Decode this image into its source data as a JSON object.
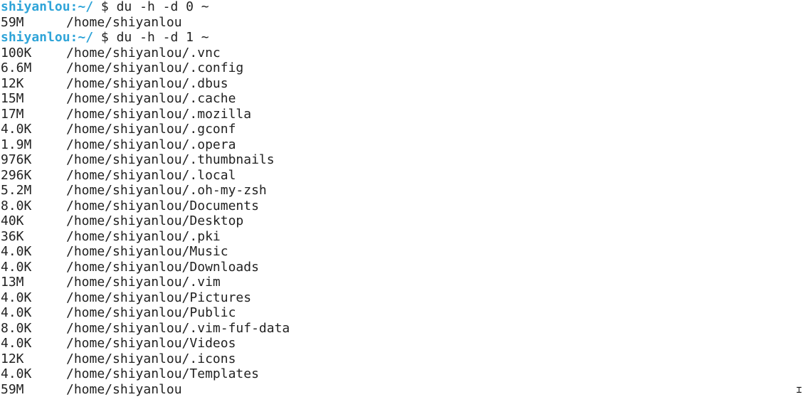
{
  "terminal": {
    "prompt": {
      "user": "shiyanlou",
      "separator": ":",
      "path": "~/",
      "symbol": " $ "
    },
    "colors": {
      "prompt": "#2fa4d8",
      "text": "#222222",
      "background": "#ffffff"
    },
    "session": [
      {
        "kind": "command",
        "text": "du -h -d 0 ~"
      },
      {
        "kind": "output",
        "size": "59M",
        "path": "/home/shiyanlou"
      },
      {
        "kind": "command",
        "text": "du -h -d 1 ~"
      },
      {
        "kind": "output",
        "size": "100K",
        "path": "/home/shiyanlou/.vnc"
      },
      {
        "kind": "output",
        "size": "6.6M",
        "path": "/home/shiyanlou/.config"
      },
      {
        "kind": "output",
        "size": "12K",
        "path": "/home/shiyanlou/.dbus"
      },
      {
        "kind": "output",
        "size": "15M",
        "path": "/home/shiyanlou/.cache"
      },
      {
        "kind": "output",
        "size": "17M",
        "path": "/home/shiyanlou/.mozilla"
      },
      {
        "kind": "output",
        "size": "4.0K",
        "path": "/home/shiyanlou/.gconf"
      },
      {
        "kind": "output",
        "size": "1.9M",
        "path": "/home/shiyanlou/.opera"
      },
      {
        "kind": "output",
        "size": "976K",
        "path": "/home/shiyanlou/.thumbnails"
      },
      {
        "kind": "output",
        "size": "296K",
        "path": "/home/shiyanlou/.local"
      },
      {
        "kind": "output",
        "size": "5.2M",
        "path": "/home/shiyanlou/.oh-my-zsh"
      },
      {
        "kind": "output",
        "size": "8.0K",
        "path": "/home/shiyanlou/Documents"
      },
      {
        "kind": "output",
        "size": "40K",
        "path": "/home/shiyanlou/Desktop"
      },
      {
        "kind": "output",
        "size": "36K",
        "path": "/home/shiyanlou/.pki"
      },
      {
        "kind": "output",
        "size": "4.0K",
        "path": "/home/shiyanlou/Music"
      },
      {
        "kind": "output",
        "size": "4.0K",
        "path": "/home/shiyanlou/Downloads"
      },
      {
        "kind": "output",
        "size": "13M",
        "path": "/home/shiyanlou/.vim"
      },
      {
        "kind": "output",
        "size": "4.0K",
        "path": "/home/shiyanlou/Pictures"
      },
      {
        "kind": "output",
        "size": "4.0K",
        "path": "/home/shiyanlou/Public"
      },
      {
        "kind": "output",
        "size": "8.0K",
        "path": "/home/shiyanlou/.vim-fuf-data"
      },
      {
        "kind": "output",
        "size": "4.0K",
        "path": "/home/shiyanlou/Videos"
      },
      {
        "kind": "output",
        "size": "12K",
        "path": "/home/shiyanlou/.icons"
      },
      {
        "kind": "output",
        "size": "4.0K",
        "path": "/home/shiyanlou/Templates"
      },
      {
        "kind": "output",
        "size": "59M",
        "path": "/home/shiyanlou"
      }
    ],
    "mouse_cursor_icon": "text-ibeam-cursor-icon"
  }
}
